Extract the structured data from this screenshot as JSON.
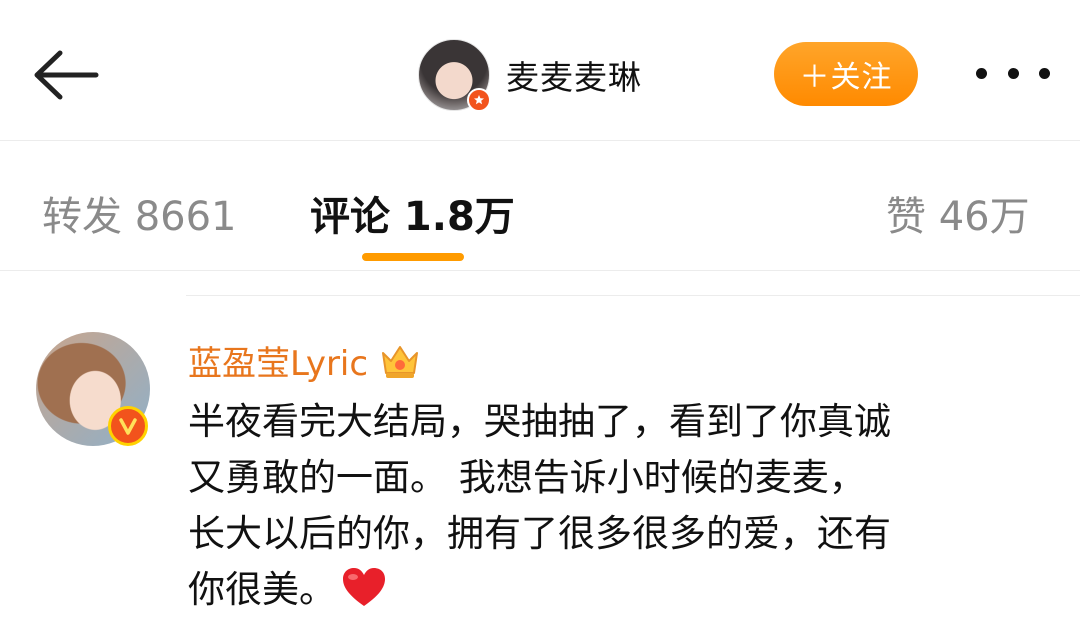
{
  "header": {
    "back_icon": "arrow-left-icon",
    "title": "麦麦麦琳",
    "follow_label": "＋关注",
    "more_icon": "more-dots-icon",
    "accent": "#ff9b00"
  },
  "tabs": {
    "repost": "转发 8661",
    "comments": "评论 1.8万",
    "likes": "赞 46万",
    "active": "comments"
  },
  "comment": {
    "author": "蓝盈莹Lyric",
    "author_color": "#e8761d",
    "badge_icon": "crown-icon",
    "verified_icon": "verified-v-icon",
    "lines": [
      "半夜看完大结局，哭抽抽了，看到了你真诚",
      "又勇敢的一面。 我想告诉小时候的麦麦，",
      "长大以后的你，拥有了很多很多的爱，还有",
      "你很美。"
    ],
    "emoji": "heart-icon"
  }
}
